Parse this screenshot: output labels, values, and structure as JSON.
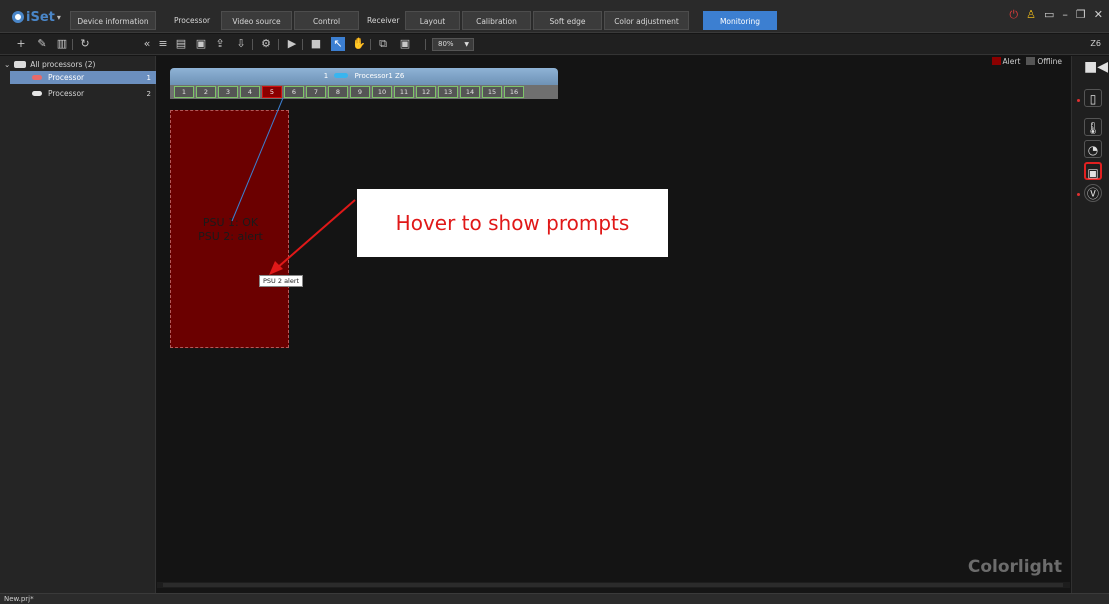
{
  "app": {
    "logo_text": "iSet"
  },
  "nav": {
    "device_information": "Device information",
    "processor_group": "Processor",
    "video_source": "Video source",
    "control": "Control",
    "receiver_group": "Receiver",
    "layout": "Layout",
    "calibration": "Calibration",
    "soft_edge": "Soft edge",
    "color_adjustment": "Color adjustment",
    "monitoring": "Monitoring"
  },
  "toolbar": {
    "zoom": "80%",
    "model_label": "Z6"
  },
  "tree": {
    "root_label": "All processors (2)",
    "items": [
      {
        "label": "Processor",
        "num": "1",
        "selected": true
      },
      {
        "label": "Processor",
        "num": "2",
        "selected": false
      }
    ]
  },
  "canvas": {
    "legend": {
      "alert": "Alert",
      "offline": "Offline"
    },
    "processor": {
      "index": "1",
      "name": "Processor1 Z6"
    },
    "ports": [
      "1",
      "2",
      "3",
      "4",
      "5",
      "6",
      "7",
      "8",
      "9",
      "10",
      "11",
      "12",
      "13",
      "14",
      "15",
      "16"
    ],
    "alert_port": "5",
    "screen": {
      "psu1": "PSU 1: OK",
      "psu2": "PSU 2: alert"
    },
    "tooltip": "PSU 2 alert",
    "callout": "Hover to show prompts",
    "brand": "Colorlight"
  },
  "statusbar": {
    "file": "New.prj*"
  },
  "colors": {
    "accent": "#3c7fd1",
    "alert": "#8b0000",
    "callout_text": "#e01818"
  }
}
